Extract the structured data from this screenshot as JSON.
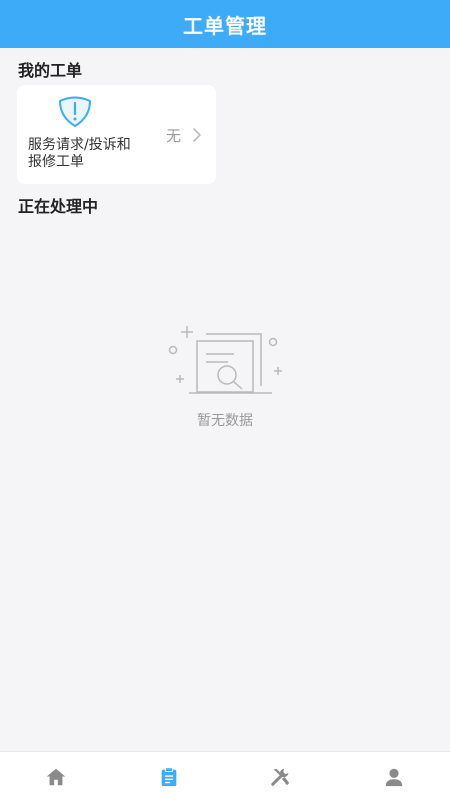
{
  "header": {
    "title": "工单管理"
  },
  "sections": {
    "mine_title": "我的工单",
    "processing_title": "正在处理中"
  },
  "ticket_card": {
    "icon": "shield-warning-icon",
    "label": "服务请求/投诉和报修工单",
    "count_text": "无"
  },
  "empty_state": {
    "icon": "empty-document-search-icon",
    "text": "暂无数据"
  },
  "tabbar": {
    "active_index": 1,
    "items": [
      {
        "icon": "home-icon"
      },
      {
        "icon": "clipboard-icon"
      },
      {
        "icon": "tools-icon"
      },
      {
        "icon": "user-icon"
      }
    ]
  },
  "colors": {
    "header_bg": "#3eabf8",
    "accent": "#3eabf8",
    "page_bg": "#f5f4f7",
    "tab_inactive": "#8a8a8a"
  }
}
